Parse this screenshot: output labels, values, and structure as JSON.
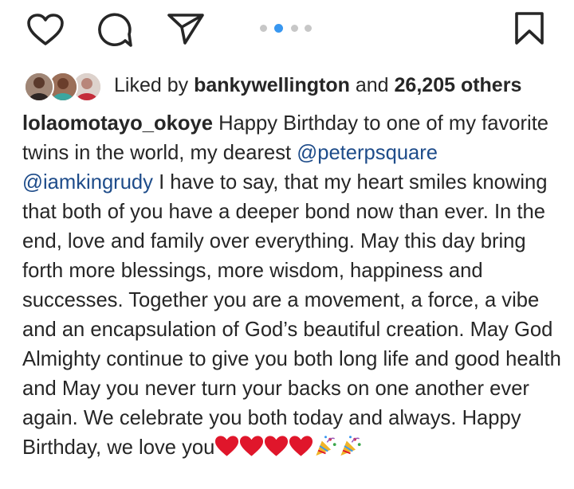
{
  "post": {
    "carousel": {
      "count": 4,
      "active_index": 1
    },
    "likes": {
      "prefix": "Liked by ",
      "user": "bankywellington",
      "middle": " and ",
      "count": "26,205 others"
    },
    "caption": {
      "username": "lolaomotayo_okoye",
      "text_1": " Happy Birthday to one of my favorite twins in the world, my dearest ",
      "mention_1": "@peterpsquare",
      "space": " ",
      "mention_2": "@iamkingrudy",
      "text_2": " I have to say, that my heart smiles knowing that both of you have a deeper bond now than ever. In the end, love and family over everything. May this day  bring forth more blessings, more wisdom, happiness and successes. Together you are a movement, a force, a vibe and an encapsulation of God’s beautiful creation. May God Almighty continue to give you both long life and good health and May you never turn your backs on one another ever again. We celebrate you both today and always.  Happy Birthday, we love you"
    },
    "emojis": [
      "red-heart",
      "red-heart",
      "red-heart",
      "red-heart",
      "party-popper",
      "party-popper"
    ],
    "colors": {
      "mention": "#1e4c8a",
      "active_dot": "#3897f0",
      "inactive_dot": "#c7c7c7",
      "heart": "#e0162b"
    }
  }
}
